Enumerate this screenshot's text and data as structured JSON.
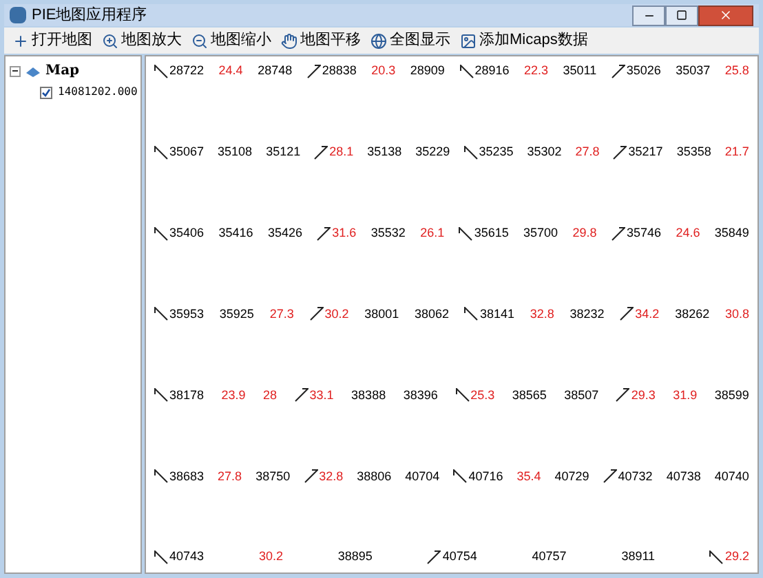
{
  "window": {
    "title": "PIE地图应用程序"
  },
  "toolbar": [
    {
      "label": "打开地图"
    },
    {
      "label": "地图放大"
    },
    {
      "label": "地图缩小"
    },
    {
      "label": "地图平移"
    },
    {
      "label": "全图显示"
    },
    {
      "label": "添加Micaps数据"
    }
  ],
  "layers": {
    "label": "Map",
    "expanded": true,
    "children": [
      {
        "label": "14081202.000",
        "checked": true
      }
    ]
  },
  "map": {
    "labels": [
      {
        "kind": "id",
        "text": "28722"
      },
      {
        "kind": "value",
        "text": "24.4"
      },
      {
        "kind": "id",
        "text": "28748"
      },
      {
        "kind": "id",
        "text": "28838"
      },
      {
        "kind": "value",
        "text": "20.3"
      },
      {
        "kind": "id",
        "text": "28909"
      },
      {
        "kind": "id",
        "text": "28916"
      },
      {
        "kind": "value",
        "text": "22.3"
      },
      {
        "kind": "id",
        "text": "35011"
      },
      {
        "kind": "id",
        "text": "35026"
      },
      {
        "kind": "id",
        "text": "35037"
      },
      {
        "kind": "value",
        "text": "25.8"
      },
      {
        "kind": "id",
        "text": "35067"
      },
      {
        "kind": "id",
        "text": "35108"
      },
      {
        "kind": "id",
        "text": "35121"
      },
      {
        "kind": "value",
        "text": "28.1"
      },
      {
        "kind": "id",
        "text": "35138"
      },
      {
        "kind": "id",
        "text": "35229"
      },
      {
        "kind": "id",
        "text": "35235"
      },
      {
        "kind": "id",
        "text": "35302"
      },
      {
        "kind": "value",
        "text": "27.8"
      },
      {
        "kind": "id",
        "text": "35217"
      },
      {
        "kind": "id",
        "text": "35358"
      },
      {
        "kind": "value",
        "text": "21.7"
      },
      {
        "kind": "id",
        "text": "35406"
      },
      {
        "kind": "id",
        "text": "35416"
      },
      {
        "kind": "id",
        "text": "35426"
      },
      {
        "kind": "value",
        "text": "31.6"
      },
      {
        "kind": "id",
        "text": "35532"
      },
      {
        "kind": "value",
        "text": "26.1"
      },
      {
        "kind": "id",
        "text": "35615"
      },
      {
        "kind": "id",
        "text": "35700"
      },
      {
        "kind": "value",
        "text": "29.8"
      },
      {
        "kind": "id",
        "text": "35746"
      },
      {
        "kind": "value",
        "text": "24.6"
      },
      {
        "kind": "id",
        "text": "35849"
      },
      {
        "kind": "id",
        "text": "35953"
      },
      {
        "kind": "id",
        "text": "35925"
      },
      {
        "kind": "value",
        "text": "27.3"
      },
      {
        "kind": "value",
        "text": "30.2"
      },
      {
        "kind": "id",
        "text": "38001"
      },
      {
        "kind": "id",
        "text": "38062"
      },
      {
        "kind": "id",
        "text": "38141"
      },
      {
        "kind": "value",
        "text": "32.8"
      },
      {
        "kind": "id",
        "text": "38232"
      },
      {
        "kind": "value",
        "text": "34.2"
      },
      {
        "kind": "id",
        "text": "38262"
      },
      {
        "kind": "value",
        "text": "30.8"
      },
      {
        "kind": "id",
        "text": "38178"
      },
      {
        "kind": "value",
        "text": "23.9"
      },
      {
        "kind": "value",
        "text": "28"
      },
      {
        "kind": "value",
        "text": "33.1"
      },
      {
        "kind": "id",
        "text": "38388"
      },
      {
        "kind": "id",
        "text": "38396"
      },
      {
        "kind": "value",
        "text": "25.3"
      },
      {
        "kind": "id",
        "text": "38565"
      },
      {
        "kind": "id",
        "text": "38507"
      },
      {
        "kind": "value",
        "text": "29.3"
      },
      {
        "kind": "value",
        "text": "31.9"
      },
      {
        "kind": "id",
        "text": "38599"
      },
      {
        "kind": "id",
        "text": "38683"
      },
      {
        "kind": "value",
        "text": "27.8"
      },
      {
        "kind": "id",
        "text": "38750"
      },
      {
        "kind": "value",
        "text": "32.8"
      },
      {
        "kind": "id",
        "text": "38806"
      },
      {
        "kind": "id",
        "text": "40704"
      },
      {
        "kind": "id",
        "text": "40716"
      },
      {
        "kind": "value",
        "text": "35.4"
      },
      {
        "kind": "id",
        "text": "40729"
      },
      {
        "kind": "id",
        "text": "40732"
      },
      {
        "kind": "id",
        "text": "40738"
      },
      {
        "kind": "id",
        "text": "40740"
      },
      {
        "kind": "id",
        "text": "40743"
      },
      {
        "kind": "value",
        "text": "30.2"
      },
      {
        "kind": "id",
        "text": "38895"
      },
      {
        "kind": "id",
        "text": "40754"
      },
      {
        "kind": "id",
        "text": "40757"
      },
      {
        "kind": "id",
        "text": "38911"
      },
      {
        "kind": "value",
        "text": "29.2"
      }
    ]
  }
}
